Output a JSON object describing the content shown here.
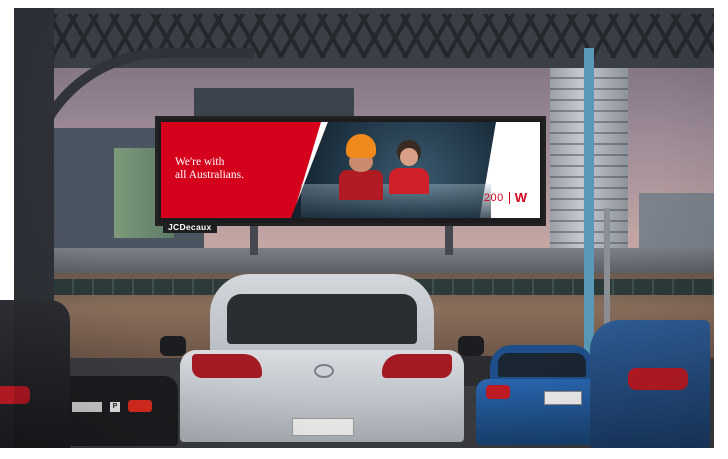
{
  "billboard": {
    "headline_line1": "We're with",
    "headline_line2": "all Australians.",
    "logo_number": "200",
    "logo_mark": "W",
    "fine_print": "",
    "tagline": ""
  },
  "operator": {
    "label": "JCDecaux"
  },
  "cars": {
    "blue_plate": "",
    "dark_plate": "",
    "dark_parking_badge": "P"
  },
  "colors": {
    "brand_red": "#d5001c",
    "car_blue": "#2a66b0"
  }
}
